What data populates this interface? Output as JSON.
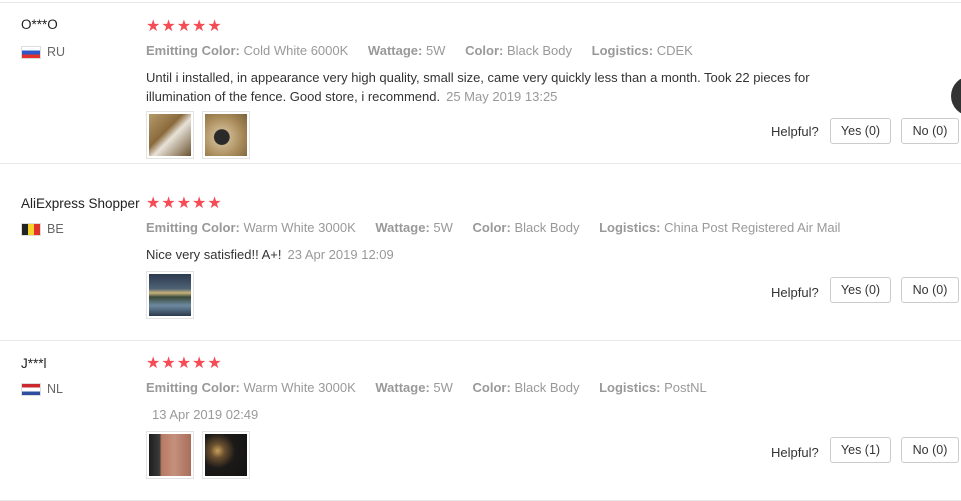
{
  "reviews": [
    {
      "user": "O***O",
      "country": "RU",
      "stars": 5,
      "attributes": [
        {
          "label": "Emitting Color:",
          "value": "Cold White 6000K"
        },
        {
          "label": "Wattage:",
          "value": "5W"
        },
        {
          "label": "Color:",
          "value": "Black Body"
        },
        {
          "label": "Logistics:",
          "value": "CDEK"
        }
      ],
      "text": "Until i installed, in appearance very high quality, small size, came very quickly less than a month. Took 22 pieces for illumination of the fence. Good store, i recommend.",
      "date": "25 May 2019 13:25",
      "helpful_label": "Helpful?",
      "yes": "Yes (0)",
      "no": "No (0)"
    },
    {
      "user": "AliExpress Shopper",
      "country": "BE",
      "stars": 5,
      "attributes": [
        {
          "label": "Emitting Color:",
          "value": "Warm White 3000K"
        },
        {
          "label": "Wattage:",
          "value": "5W"
        },
        {
          "label": "Color:",
          "value": "Black Body"
        },
        {
          "label": "Logistics:",
          "value": "China Post Registered Air Mail"
        }
      ],
      "text": "Nice very satisfied!! A+!",
      "date": "23 Apr 2019 12:09",
      "helpful_label": "Helpful?",
      "yes": "Yes (0)",
      "no": "No (0)"
    },
    {
      "user": "J***l",
      "country": "NL",
      "stars": 5,
      "attributes": [
        {
          "label": "Emitting Color:",
          "value": "Warm White 3000K"
        },
        {
          "label": "Wattage:",
          "value": "5W"
        },
        {
          "label": "Color:",
          "value": "Black Body"
        },
        {
          "label": "Logistics:",
          "value": "PostNL"
        }
      ],
      "text": "",
      "date": "13 Apr 2019 02:49",
      "helpful_label": "Helpful?",
      "yes": "Yes (1)",
      "no": "No (0)"
    }
  ]
}
